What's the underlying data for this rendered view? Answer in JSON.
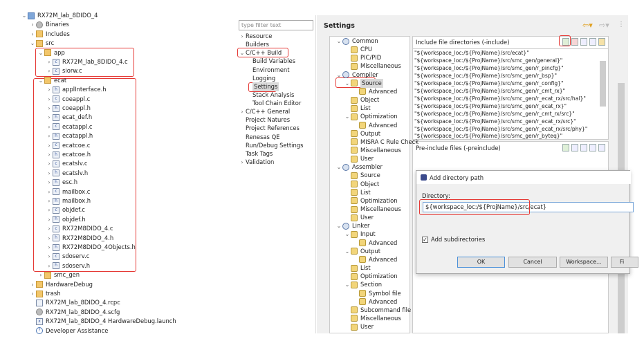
{
  "project_tree": [
    {
      "label": "RX72M_lab_8DIDO_4",
      "icon": "project-icon",
      "depth": 0,
      "chev": "v"
    },
    {
      "label": "Binaries",
      "icon": "binaries-icon",
      "depth": 1,
      "chev": ">"
    },
    {
      "label": "Includes",
      "icon": "includes-icon",
      "depth": 1,
      "chev": ">"
    },
    {
      "label": "src",
      "icon": "folder-icon",
      "depth": 1,
      "chev": "v"
    },
    {
      "label": "app",
      "icon": "folder-icon",
      "depth": 2,
      "chev": "v"
    },
    {
      "label": "RX72M_lab_8DIDO_4.c",
      "icon": "c-file-icon",
      "depth": 3,
      "chev": ">"
    },
    {
      "label": "siorw.c",
      "icon": "c-file-icon",
      "depth": 3,
      "chev": ">"
    },
    {
      "label": "ecat",
      "icon": "folder-icon",
      "depth": 2,
      "chev": "v"
    },
    {
      "label": "applInterface.h",
      "icon": "h-file-icon",
      "depth": 3,
      "chev": ">"
    },
    {
      "label": "coeappl.c",
      "icon": "c-file-icon",
      "depth": 3,
      "chev": ">"
    },
    {
      "label": "coeappl.h",
      "icon": "h-file-icon",
      "depth": 3,
      "chev": ">"
    },
    {
      "label": "ecat_def.h",
      "icon": "h-file-icon",
      "depth": 3,
      "chev": ">"
    },
    {
      "label": "ecatappl.c",
      "icon": "c-file-icon",
      "depth": 3,
      "chev": ">"
    },
    {
      "label": "ecatappl.h",
      "icon": "h-file-icon",
      "depth": 3,
      "chev": ">"
    },
    {
      "label": "ecatcoe.c",
      "icon": "c-file-icon",
      "depth": 3,
      "chev": ">"
    },
    {
      "label": "ecatcoe.h",
      "icon": "h-file-icon",
      "depth": 3,
      "chev": ">"
    },
    {
      "label": "ecatslv.c",
      "icon": "c-file-icon",
      "depth": 3,
      "chev": ">"
    },
    {
      "label": "ecatslv.h",
      "icon": "h-file-icon",
      "depth": 3,
      "chev": ">"
    },
    {
      "label": "esc.h",
      "icon": "h-file-icon",
      "depth": 3,
      "chev": ">"
    },
    {
      "label": "mailbox.c",
      "icon": "c-file-icon",
      "depth": 3,
      "chev": ">"
    },
    {
      "label": "mailbox.h",
      "icon": "h-file-icon",
      "depth": 3,
      "chev": ">"
    },
    {
      "label": "objdef.c",
      "icon": "c-file-icon",
      "depth": 3,
      "chev": ">"
    },
    {
      "label": "objdef.h",
      "icon": "h-file-icon",
      "depth": 3,
      "chev": ">"
    },
    {
      "label": "RX72M8DIDO_4.c",
      "icon": "c-file-icon",
      "depth": 3,
      "chev": ">"
    },
    {
      "label": "RX72M8DIDO_4.h",
      "icon": "h-file-icon",
      "depth": 3,
      "chev": ">"
    },
    {
      "label": "RX72M8DIDO_4Objects.h",
      "icon": "h-file-icon",
      "depth": 3,
      "chev": ">"
    },
    {
      "label": "sdoserv.c",
      "icon": "c-file-icon",
      "depth": 3,
      "chev": ">"
    },
    {
      "label": "sdoserv.h",
      "icon": "h-file-icon",
      "depth": 3,
      "chev": ">"
    },
    {
      "label": "smc_gen",
      "icon": "folder-icon",
      "depth": 2,
      "chev": ">"
    },
    {
      "label": "HardwareDebug",
      "icon": "folder-icon",
      "depth": 1,
      "chev": ">"
    },
    {
      "label": "trash",
      "icon": "folder-icon",
      "depth": 1,
      "chev": ">"
    },
    {
      "label": "RX72M_lab_8DIDO_4.rcpc",
      "icon": "file-icon",
      "depth": 1,
      "chev": ""
    },
    {
      "label": "RX72M_lab_8DIDO_4.scfg",
      "icon": "gear-icon",
      "depth": 1,
      "chev": ""
    },
    {
      "label": "RX72M_lab_8DIDO_4 HardwareDebug.launch",
      "icon": "launch-icon",
      "depth": 1,
      "chev": ""
    },
    {
      "label": "Developer Assistance",
      "icon": "help-icon",
      "depth": 1,
      "chev": ""
    }
  ],
  "properties_nav": {
    "filter_placeholder": "type filter text",
    "items": [
      {
        "label": "Resource",
        "depth": 0,
        "chev": ">"
      },
      {
        "label": "Builders",
        "depth": 0,
        "chev": ""
      },
      {
        "label": "C/C++ Build",
        "depth": 0,
        "chev": "v"
      },
      {
        "label": "Build Variables",
        "depth": 1,
        "chev": ""
      },
      {
        "label": "Environment",
        "depth": 1,
        "chev": ""
      },
      {
        "label": "Logging",
        "depth": 1,
        "chev": ""
      },
      {
        "label": "Settings",
        "depth": 1,
        "chev": "",
        "selected": true
      },
      {
        "label": "Stack Analysis",
        "depth": 1,
        "chev": ""
      },
      {
        "label": "Tool Chain Editor",
        "depth": 1,
        "chev": ""
      },
      {
        "label": "C/C++ General",
        "depth": 0,
        "chev": ">"
      },
      {
        "label": "Project Natures",
        "depth": 0,
        "chev": ""
      },
      {
        "label": "Project References",
        "depth": 0,
        "chev": ""
      },
      {
        "label": "Renesas QE",
        "depth": 0,
        "chev": ""
      },
      {
        "label": "Run/Debug Settings",
        "depth": 0,
        "chev": ""
      },
      {
        "label": "Task Tags",
        "depth": 0,
        "chev": ""
      },
      {
        "label": "Validation",
        "depth": 0,
        "chev": ">"
      }
    ]
  },
  "settings": {
    "title": "Settings",
    "tool_tree": [
      {
        "label": "Common",
        "depth": 0,
        "chev": "v",
        "group": true
      },
      {
        "label": "CPU",
        "depth": 1,
        "chev": ""
      },
      {
        "label": "PIC/PID",
        "depth": 1,
        "chev": ""
      },
      {
        "label": "Miscellaneous",
        "depth": 1,
        "chev": ""
      },
      {
        "label": "Compiler",
        "depth": 0,
        "chev": "v",
        "group": true
      },
      {
        "label": "Source",
        "depth": 1,
        "chev": "v",
        "selected": true
      },
      {
        "label": "Advanced",
        "depth": 2,
        "chev": ""
      },
      {
        "label": "Object",
        "depth": 1,
        "chev": ""
      },
      {
        "label": "List",
        "depth": 1,
        "chev": ""
      },
      {
        "label": "Optimization",
        "depth": 1,
        "chev": "v"
      },
      {
        "label": "Advanced",
        "depth": 2,
        "chev": ""
      },
      {
        "label": "Output",
        "depth": 1,
        "chev": ""
      },
      {
        "label": "MISRA C Rule Check",
        "depth": 1,
        "chev": ""
      },
      {
        "label": "Miscellaneous",
        "depth": 1,
        "chev": ""
      },
      {
        "label": "User",
        "depth": 1,
        "chev": ""
      },
      {
        "label": "Assembler",
        "depth": 0,
        "chev": "v",
        "group": true
      },
      {
        "label": "Source",
        "depth": 1,
        "chev": ""
      },
      {
        "label": "Object",
        "depth": 1,
        "chev": ""
      },
      {
        "label": "List",
        "depth": 1,
        "chev": ""
      },
      {
        "label": "Optimization",
        "depth": 1,
        "chev": ""
      },
      {
        "label": "Miscellaneous",
        "depth": 1,
        "chev": ""
      },
      {
        "label": "User",
        "depth": 1,
        "chev": ""
      },
      {
        "label": "Linker",
        "depth": 0,
        "chev": "v",
        "group": true
      },
      {
        "label": "Input",
        "depth": 1,
        "chev": "v"
      },
      {
        "label": "Advanced",
        "depth": 2,
        "chev": ""
      },
      {
        "label": "Output",
        "depth": 1,
        "chev": "v"
      },
      {
        "label": "Advanced",
        "depth": 2,
        "chev": ""
      },
      {
        "label": "List",
        "depth": 1,
        "chev": ""
      },
      {
        "label": "Optimization",
        "depth": 1,
        "chev": ""
      },
      {
        "label": "Section",
        "depth": 1,
        "chev": "v"
      },
      {
        "label": "Symbol file",
        "depth": 2,
        "chev": ""
      },
      {
        "label": "Advanced",
        "depth": 2,
        "chev": ""
      },
      {
        "label": "Subcommand file",
        "depth": 1,
        "chev": ""
      },
      {
        "label": "Miscellaneous",
        "depth": 1,
        "chev": ""
      },
      {
        "label": "User",
        "depth": 1,
        "chev": ""
      }
    ],
    "include_header": "Include file directories (-include)",
    "include_dirs": [
      "\"${workspace_loc:/${ProjName}/src/ecat}\"",
      "\"${workspace_loc:/${ProjName}/src/smc_gen/general}\"",
      "\"${workspace_loc:/${ProjName}/src/smc_gen/r_pincfg}\"",
      "\"${workspace_loc:/${ProjName}/src/smc_gen/r_bsp}\"",
      "\"${workspace_loc:/${ProjName}/src/smc_gen/r_config}\"",
      "\"${workspace_loc:/${ProjName}/src/smc_gen/r_cmt_rx}\"",
      "\"${workspace_loc:/${ProjName}/src/smc_gen/r_ecat_rx/src/hal}\"",
      "\"${workspace_loc:/${ProjName}/src/smc_gen/r_ecat_rx}\"",
      "\"${workspace_loc:/${ProjName}/src/smc_gen/r_cmt_rx/src}\"",
      "\"${workspace_loc:/${ProjName}/src/smc_gen/r_ecat_rx/src}\"",
      "\"${workspace_loc:/${ProjName}/src/smc_gen/r_ecat_rx/src/phy}\"",
      "\"${workspace_loc:/${ProjName}/src/smc_gen/r_byteq}\""
    ],
    "preinclude_header": "Pre-include files (-preinclude)"
  },
  "dialog": {
    "title": "Add directory path",
    "directory_label": "Directory:",
    "directory_value": "${workspace_loc:/${ProjName}/src/ecat}",
    "subdirs_label": "Add subdirectories",
    "subdirs_checked": true,
    "ok": "OK",
    "cancel": "Cancel",
    "workspace": "Workspace...",
    "file": "Fi"
  },
  "colors": {
    "highlight": "#e53935",
    "selection": "#d9d9d9"
  }
}
